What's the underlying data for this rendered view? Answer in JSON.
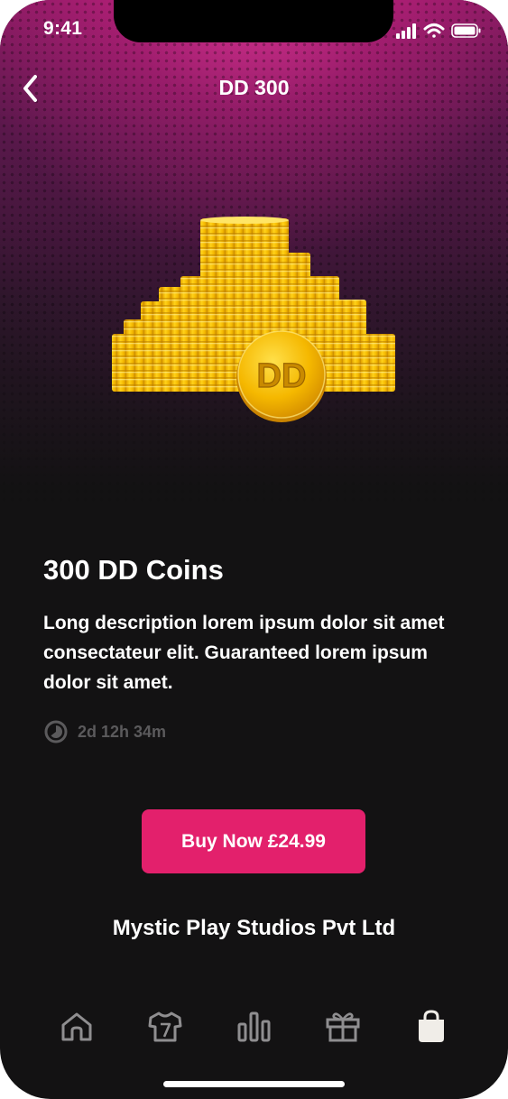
{
  "status_bar": {
    "time": "9:41"
  },
  "header": {
    "title": "DD 300",
    "back_icon": "chevron-left-icon"
  },
  "hero": {
    "coin_label": "DD",
    "image": "coin-stack-illustration"
  },
  "item": {
    "title": "300 DD Coins",
    "description": "Long description lorem ipsum dolor sit amet consectateur elit. Guaranteed lorem ipsum dolor sit amet.",
    "timer_icon": "clock-icon",
    "time_remaining": "2d 12h 34m"
  },
  "buy_button": {
    "label": "Buy Now £24.99"
  },
  "publisher": "Mystic Play Studios Pvt Ltd",
  "tabbar": {
    "items": [
      {
        "icon": "home-icon",
        "active": false
      },
      {
        "icon": "jersey-icon",
        "active": false
      },
      {
        "icon": "leaderboard-icon",
        "active": false
      },
      {
        "icon": "gift-icon",
        "active": false
      },
      {
        "icon": "shopping-bag-icon",
        "active": true
      }
    ]
  },
  "colors": {
    "accent": "#e3206c",
    "background": "#131213",
    "hero_top": "#a11e6e",
    "muted_text": "#5b5a5c",
    "tab_icon": "#8f8e90",
    "coin_gold": "#f5c400"
  }
}
